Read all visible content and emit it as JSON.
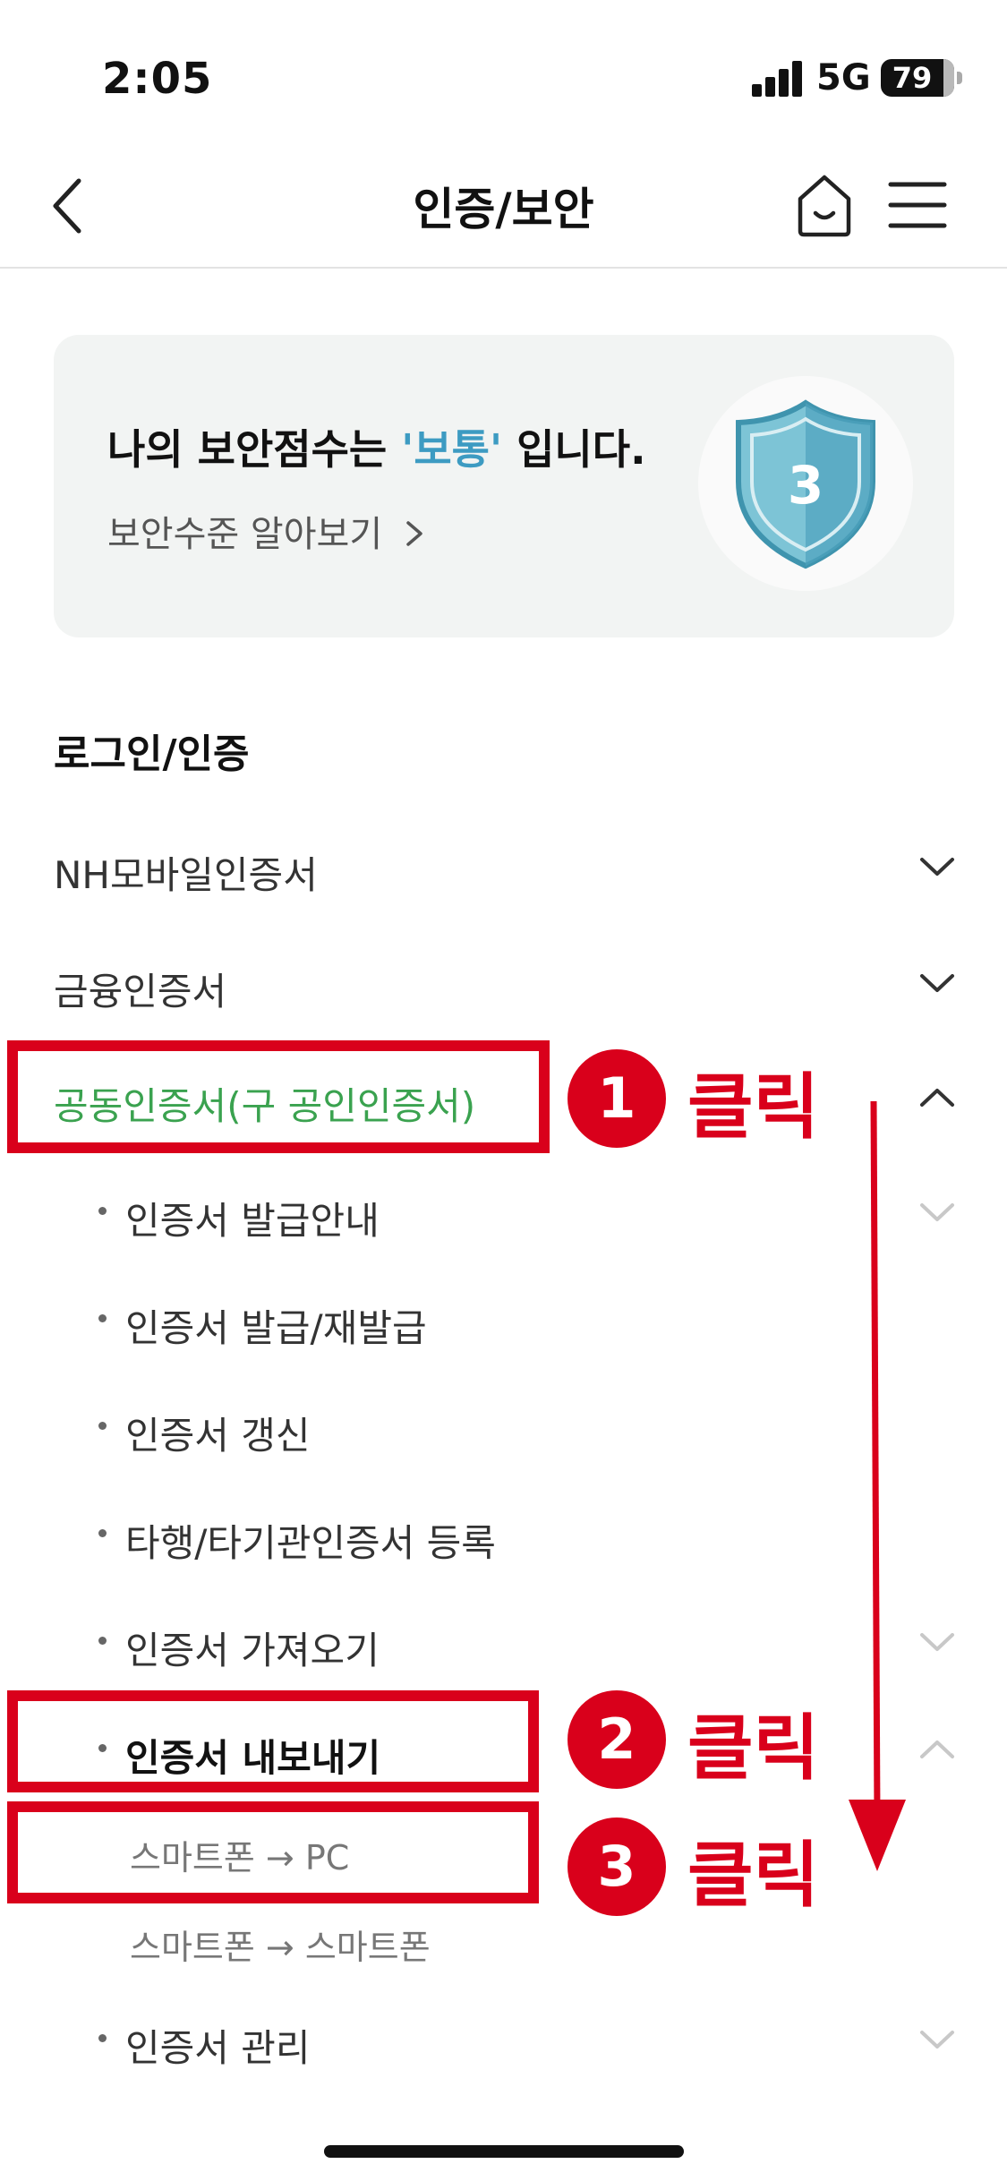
{
  "status_bar": {
    "time": "2:05",
    "network": "5G",
    "battery": "79"
  },
  "header": {
    "title": "인증/보안",
    "icons": [
      "back-chevron-icon",
      "home-icon",
      "menu-icon"
    ]
  },
  "security_card": {
    "score_prefix": "나의 보안점수는 ",
    "score_level": "'보통'",
    "score_suffix": " 입니다.",
    "link_text": "보안수준 알아보기",
    "badge_value": "3",
    "level_color": "#3d9bc2"
  },
  "section": {
    "title": "로그인/인증"
  },
  "menu": {
    "nh_mobile": "NH모바일인증서",
    "financial": "금융인증서",
    "joint": "공동인증서(구 공인인증서)",
    "sub": {
      "issue_guide": "인증서 발급안내",
      "issue_reissue": "인증서 발급/재발급",
      "renew": "인증서 갱신",
      "register_other": "타행/타기관인증서 등록",
      "import": "인증서 가져오기",
      "export": "인증서 내보내기",
      "export_pc": "스마트폰 → PC",
      "export_phone": "스마트폰 → 스마트폰",
      "manage": "인증서 관리"
    }
  },
  "annotations": {
    "step1": "1",
    "step2": "2",
    "step3": "3",
    "click_label": "클릭",
    "color": "#d9001b"
  }
}
